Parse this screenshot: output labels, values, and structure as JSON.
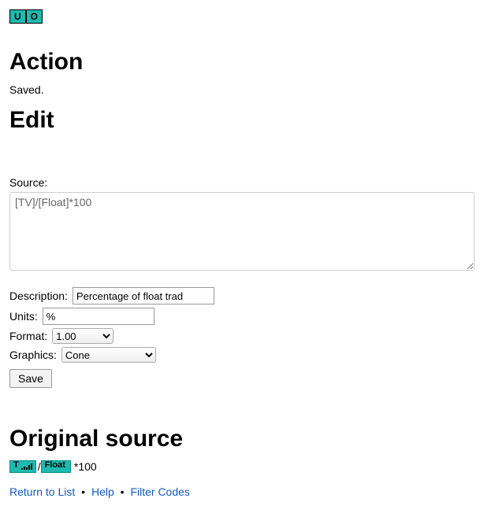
{
  "header": {
    "badges": [
      "U",
      "O"
    ]
  },
  "action": {
    "heading": "Action",
    "status": "Saved."
  },
  "edit": {
    "heading": "Edit",
    "source_label": "Source:",
    "source_value": "[TV]/[Float]*100",
    "description_label": "Description:",
    "description_value": "Percentage of float trad",
    "units_label": "Units:",
    "units_value": "%",
    "format_label": "Format:",
    "format_options": [
      "1.00"
    ],
    "format_value": "1.00",
    "graphics_label": "Graphics:",
    "graphics_options": [
      "Cone"
    ],
    "graphics_value": "Cone",
    "save_label": "Save"
  },
  "original": {
    "heading": "Original source",
    "tokens": {
      "tv": "T",
      "float": "Float"
    },
    "separator": "/",
    "suffix": "*100"
  },
  "links": {
    "return": "Return to List",
    "help": "Help",
    "filter": "Filter Codes",
    "sep": "•"
  }
}
